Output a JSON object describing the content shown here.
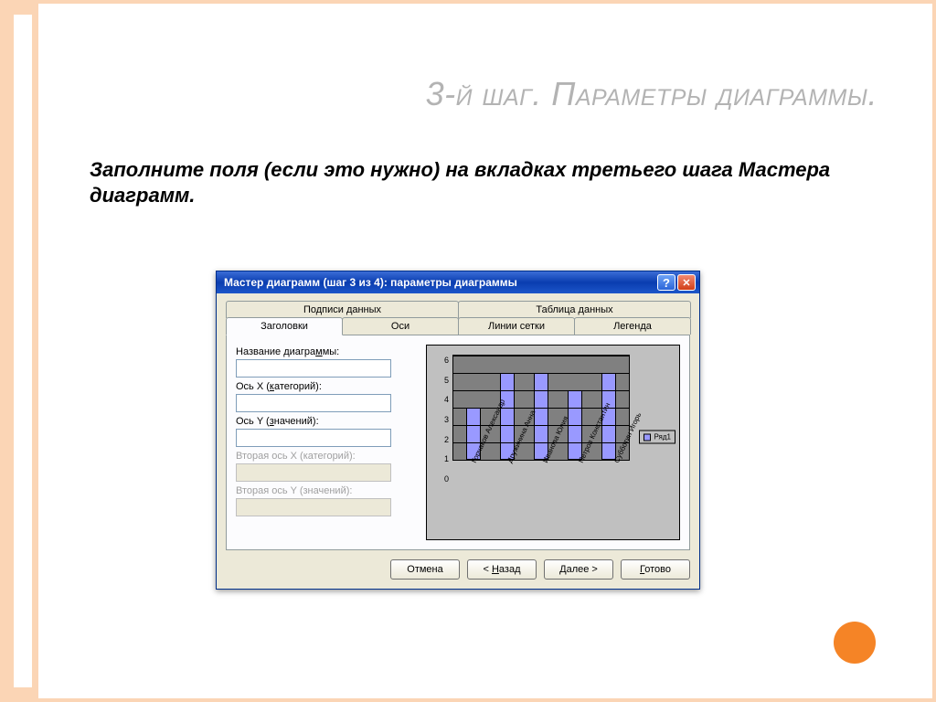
{
  "slide": {
    "title": "3-й шаг. Параметры диаграммы.",
    "body": "Заполните поля (если это нужно) на вкладках третьего шага Мастера диаграмм."
  },
  "dialog": {
    "title": "Мастер диаграмм (шаг 3 из 4): параметры диаграммы",
    "help_glyph": "?",
    "close_glyph": "✕",
    "tabs_top": [
      "Подписи данных",
      "Таблица данных"
    ],
    "tabs_bottom": [
      "Заголовки",
      "Оси",
      "Линии сетки",
      "Легенда"
    ],
    "active_tab": "Заголовки",
    "fields": {
      "chart_title_label": "Название диагра",
      "chart_title_label_ul": "м",
      "chart_title_label_after": "мы:",
      "chart_title_value": "",
      "x_axis_label": "Ось X (",
      "x_axis_label_ul": "к",
      "x_axis_label_after": "атегорий):",
      "x_axis_value": "",
      "y_axis_label": "Ось Y (",
      "y_axis_label_ul": "з",
      "y_axis_label_after": "начений):",
      "y_axis_value": "",
      "x2_label": "Вторая ось X (категорий):",
      "x2_value": "",
      "y2_label": "Вторая ось Y (значений):",
      "y2_value": ""
    },
    "buttons": {
      "cancel": "Отмена",
      "back_pre": "< ",
      "back_ul": "Н",
      "back_after": "азад",
      "next_ul": "Д",
      "next_after": "алее >",
      "finish_ul": "Г",
      "finish_after": "отово"
    },
    "legend_label": "Ряд1"
  },
  "chart_data": {
    "type": "bar",
    "categories": [
      "Горчаков Александр",
      "Дружинина Анна",
      "Иванова Юлия",
      "Петров Константин",
      "Субботин Игорь"
    ],
    "values": [
      3,
      5,
      5,
      4,
      5
    ],
    "series_name": "Ряд1",
    "ylim": [
      0,
      6
    ],
    "y_ticks": [
      0,
      1,
      2,
      3,
      4,
      5,
      6
    ],
    "title": "",
    "xlabel": "",
    "ylabel": ""
  }
}
